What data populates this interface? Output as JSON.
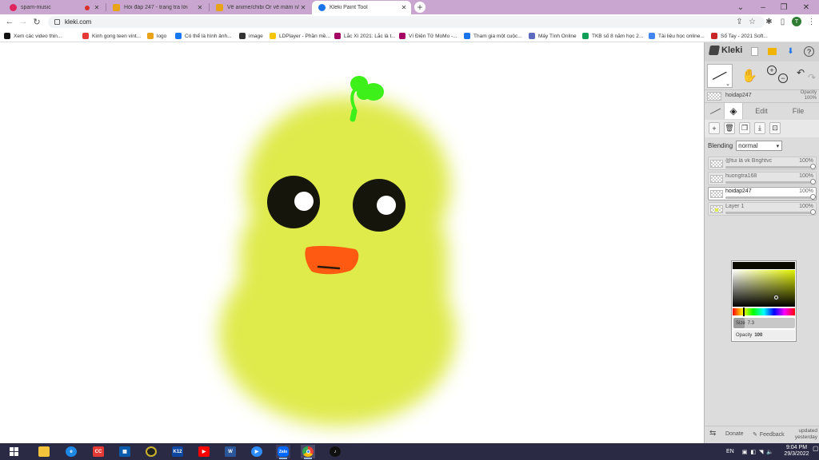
{
  "browser": {
    "tabs": [
      {
        "title": "spam-music",
        "color": "#e0245e",
        "recording": true
      },
      {
        "title": "Hỏi đáp 247 - trang tra lời",
        "color": "#e8a317"
      },
      {
        "title": "Vẽ anime/chibi Or vẽ mầm n/t Vị",
        "color": "#e8a317"
      },
      {
        "title": "Kleki Paint Tool",
        "color": "#1a73e8",
        "active": true
      }
    ],
    "url": "kleki.com",
    "profile_initial": "T"
  },
  "bookmarks": [
    {
      "label": "Xem các video thin...",
      "color": "#111"
    },
    {
      "label": "Kinh gong teen vint...",
      "color": "#333"
    },
    {
      "label": "Kinh gong teen vint...",
      "color": "#e53935"
    },
    {
      "label": "logo",
      "color": "#e8a317"
    },
    {
      "label": "Có thể là hình ảnh...",
      "color": "#1877f2"
    },
    {
      "label": "image",
      "color": "#333"
    },
    {
      "label": "LDPlayer - Phần mề...",
      "color": "#f5c400"
    },
    {
      "label": "Lắc Xì 2021: Lắc là t...",
      "color": "#a50064"
    },
    {
      "label": "Ví Điện Tử MoMo -...",
      "color": "#a50064"
    },
    {
      "label": "Tham gia một cuộc...",
      "color": "#1a73e8"
    },
    {
      "label": "Máy Tính Online",
      "color": "#5c6bc0"
    },
    {
      "label": "TKB số 8 năm học 2...",
      "color": "#0f9d58"
    },
    {
      "label": "Tài liệu học online...",
      "color": "#4285f4"
    },
    {
      "label": "Sổ Tay - 2021 Soft...",
      "color": "#c62828"
    }
  ],
  "kleki": {
    "logo": "Kleki",
    "active_layer_name": "hoidap247",
    "opacity_label": "Opacity",
    "opacity_value": "100%",
    "tabs": [
      "Edit",
      "File"
    ],
    "blending_label": "Blending",
    "blending_value": "normal",
    "layers": [
      {
        "name": "@tui là vk Brightvc",
        "opacity": "100%",
        "selected": false
      },
      {
        "name": "huongtra168",
        "opacity": "100%",
        "selected": false
      },
      {
        "name": "hoidap247",
        "opacity": "100%",
        "selected": true
      },
      {
        "name": "Layer 1",
        "opacity": "100%",
        "selected": false
      }
    ],
    "brush": {
      "size_label": "Size",
      "size_value": "7.3",
      "size_fraction": 0.18,
      "opacity_label": "Opacity",
      "opacity_value": "100"
    },
    "footer": {
      "donate": "Donate",
      "feedback": "Feedback",
      "updated": "updated",
      "updated_when": "yesterday"
    }
  },
  "colors": {
    "body": "#dfea4c",
    "eye": "#15150c",
    "beak": "#ff5a12",
    "sprout": "#3df019"
  },
  "taskbar": {
    "lang": "EN",
    "time": "9:04 PM",
    "date": "29/3/2022",
    "apps": [
      "windows",
      "file-explorer",
      "edge",
      "cc",
      "store",
      "media",
      "k12",
      "youtube",
      "word",
      "zoom",
      "zalo",
      "chrome",
      "tiktok"
    ]
  }
}
